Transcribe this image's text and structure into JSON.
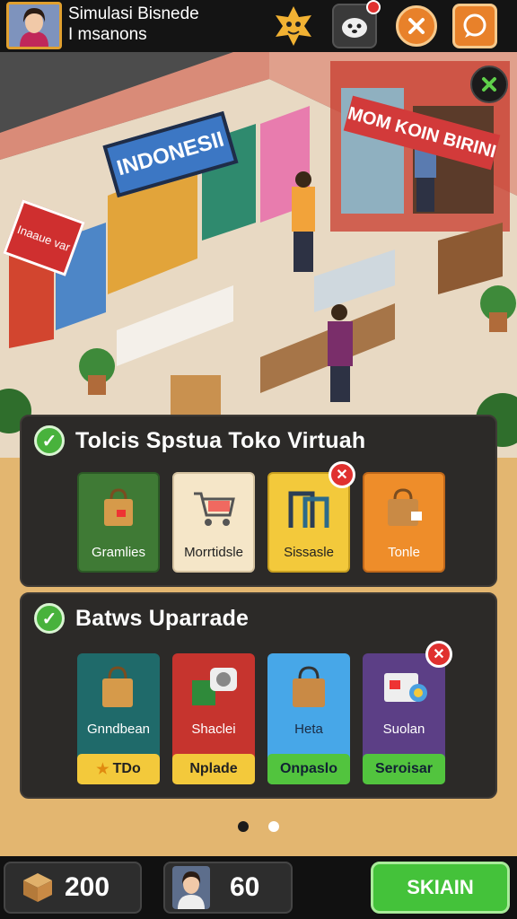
{
  "header": {
    "title_line1": "Simulasi Bisnede",
    "title_line2": "I msanons"
  },
  "scene": {
    "store_sign": "INDONESII",
    "shop_sign": "MOM KOIN BIRINI",
    "left_sign": "Inaaue var"
  },
  "panel1": {
    "title": "Tolcis Spstua Toko Virtuah",
    "cards": [
      {
        "label": "Gramlies",
        "color": "#3f7a35"
      },
      {
        "label": "Morrtidsle",
        "color": "#f5e6c8"
      },
      {
        "label": "Sissasle",
        "color": "#f3c93b"
      },
      {
        "label": "Tonle",
        "color": "#ee8d2a"
      }
    ]
  },
  "panel2": {
    "title": "Batws Uparrade",
    "cards": [
      {
        "label": "Gnndbean",
        "button": "TDo",
        "color": "#1f6a6a",
        "button_color": "#f3c93b"
      },
      {
        "label": "Shaclei",
        "button": "Nplade",
        "color": "#c6342e",
        "button_color": "#f3c93b"
      },
      {
        "label": "Heta",
        "button": "Onpaslo",
        "color": "#47a7e8",
        "button_color": "#52c43e"
      },
      {
        "label": "Suolan",
        "button": "Seroisar",
        "color": "#5c3f86",
        "button_color": "#52c43e"
      }
    ]
  },
  "footer": {
    "boxes_count": "200",
    "staff_count": "60",
    "action_label": "SKIAIN"
  }
}
